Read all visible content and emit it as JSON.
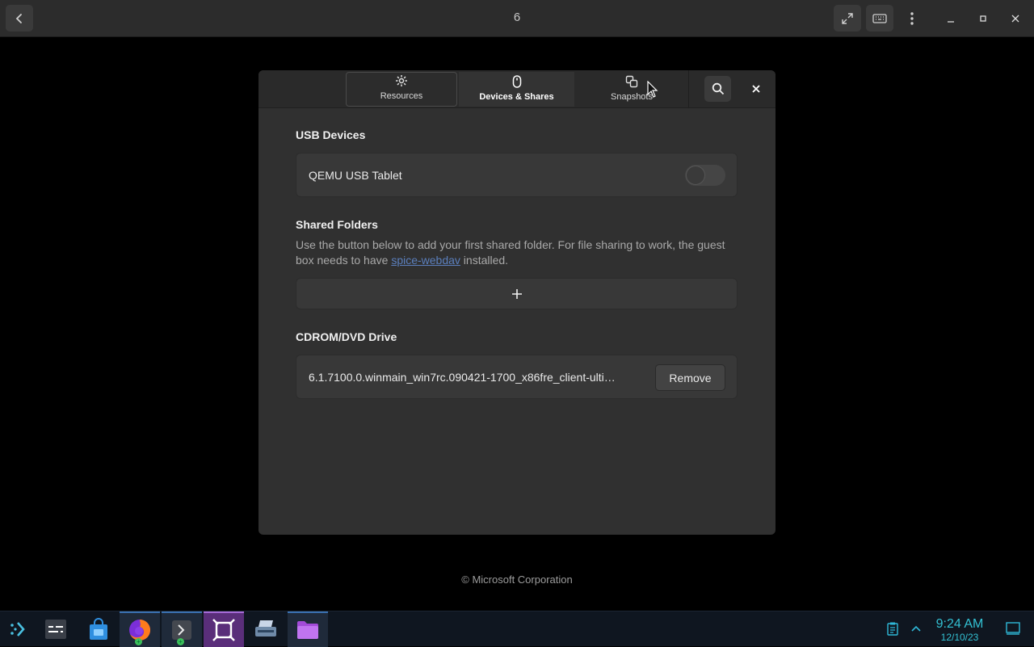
{
  "header": {
    "title": "6",
    "icons": [
      "back-arrow-icon",
      "fullscreen-icon",
      "keyboard-icon",
      "vertical-dots-icon",
      "minimize-icon",
      "maximize-icon",
      "close-icon"
    ]
  },
  "dialog": {
    "tabs": [
      {
        "label": "Resources",
        "icon": "gear-icon"
      },
      {
        "label": "Devices & Shares",
        "icon": "mouse-icon"
      },
      {
        "label": "Snapshots",
        "icon": "copy-icon"
      }
    ],
    "usb": {
      "title": "USB Devices",
      "device_label": "QEMU USB Tablet",
      "enabled": false
    },
    "shared": {
      "title": "Shared Folders",
      "desc_before": "Use the button below to add your first shared folder. For file sharing to work, the guest box needs to have ",
      "link": "spice-webdav",
      "desc_after": " installed.",
      "add_icon": "plus-icon"
    },
    "cdrom": {
      "title": "CDROM/DVD Drive",
      "file": "6.1.7100.0.winmain_win7rc.090421-1700_x86fre_client-ulti…",
      "remove_label": "Remove"
    }
  },
  "copyright": "© Microsoft Corporation",
  "taskbar": {
    "apps": [
      "launcher-icon",
      "system-settings-icon",
      "store-icon",
      "firefox-icon",
      "terminal-icon",
      "boxes-icon",
      "scanner-icon",
      "files-icon"
    ],
    "clock_time": "9:24 AM",
    "clock_date": "12/10/23"
  },
  "colors": {
    "accent": "#33c1d3",
    "link": "#5b7fbd",
    "dialog_bg": "#303030",
    "taskbar_bg": "#0f1620"
  }
}
